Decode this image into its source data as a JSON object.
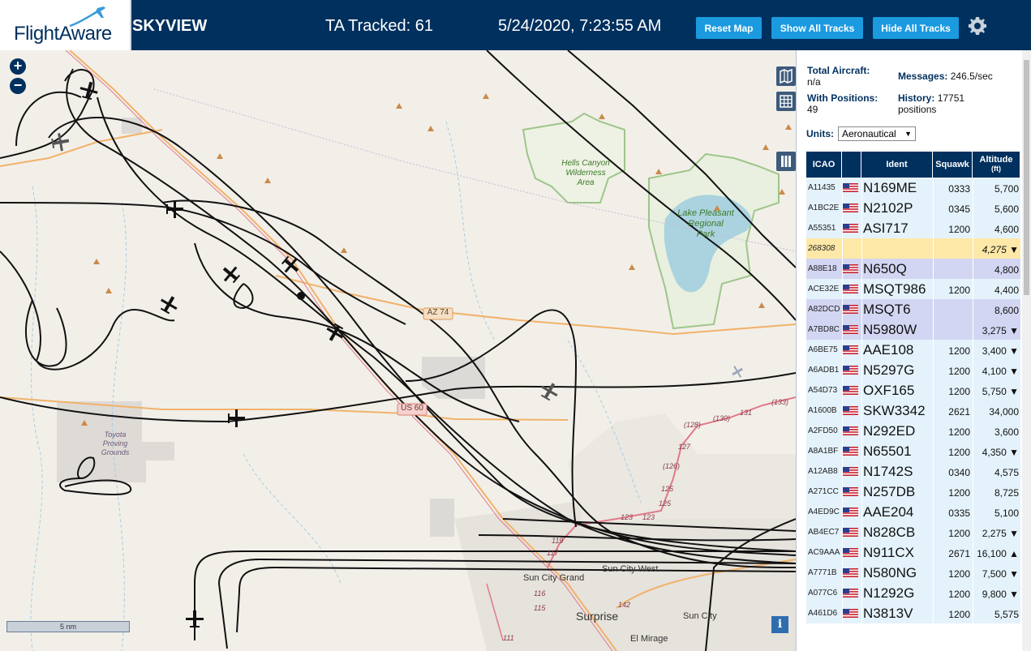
{
  "header": {
    "logo": "FlightAware",
    "app_title": "SKYVIEW",
    "tracked": "TA Tracked: 61",
    "datetime": "5/24/2020, 7:23:55 AM",
    "reset_map": "Reset Map",
    "show_all": "Show All Tracks",
    "hide_all": "Hide All Tracks"
  },
  "map": {
    "zoom_in": "+",
    "zoom_out": "−",
    "scale_label": "5 nm",
    "info": "i",
    "labels": {
      "hells_canyon": "Hells Canyon",
      "wilderness": "Wilderness",
      "area": "Area",
      "lake_pleasant": "Lake Pleasant",
      "regional": "Regional",
      "park": "Park",
      "toyota": "Toyota",
      "proving": "Proving",
      "grounds": "Grounds",
      "az74": "AZ 74",
      "us60": "US 60",
      "sun_city_grand": "Sun City Grand",
      "sun_city_west": "Sun City West",
      "surprise": "Surprise",
      "sun_city": "Sun City",
      "el_mirage": "El Mirage",
      "r133": "(133)",
      "r131": "131",
      "r130": "(130)",
      "r128": "(128)",
      "r127": "127",
      "r126": "(126)",
      "r125": "125",
      "r125b": "125",
      "r123": "123",
      "r123b": "123",
      "r119": "119",
      "r117": "117",
      "r116": "116",
      "r115": "115",
      "r142": "142",
      "r111": "111"
    }
  },
  "stats": {
    "total_label": "Total Aircraft:",
    "total_value": "n/a",
    "positions_label": "With Positions:",
    "positions_value": "49",
    "messages_label": "Messages:",
    "messages_value": "246.5/sec",
    "history_label": "History:",
    "history_value": "17751",
    "history_unit": "positions"
  },
  "units": {
    "label": "Units:",
    "selected": "Aeronautical"
  },
  "table": {
    "headers": {
      "icao": "ICAO",
      "ident": "Ident",
      "squawk": "Squawk",
      "altitude": "Altitude",
      "alt_unit": "(ft)"
    },
    "rows": [
      {
        "icao": "A11435",
        "ident": "N169ME",
        "squawk": "0333",
        "alt": "5,700",
        "bg": "n",
        "flag": true
      },
      {
        "icao": "A1BC2E",
        "ident": "N2102P",
        "squawk": "0345",
        "alt": "5,600",
        "bg": "n",
        "flag": true
      },
      {
        "icao": "A55351",
        "ident": "ASI717",
        "squawk": "1200",
        "alt": "4,600",
        "bg": "n",
        "flag": true
      },
      {
        "icao": "268308",
        "ident": "",
        "squawk": "",
        "alt": "4,275 ▼",
        "bg": "hl",
        "flag": false
      },
      {
        "icao": "A88E18",
        "ident": "N650Q",
        "squawk": "",
        "alt": "4,800",
        "bg": "alt",
        "flag": true
      },
      {
        "icao": "ACE32E",
        "ident": "MSQT986",
        "squawk": "1200",
        "alt": "4,400",
        "bg": "n",
        "flag": true
      },
      {
        "icao": "A82DCD",
        "ident": "MSQT6",
        "squawk": "",
        "alt": "8,600",
        "bg": "alt",
        "flag": true
      },
      {
        "icao": "A7BD8C",
        "ident": "N5980W",
        "squawk": "",
        "alt": "3,275 ▼",
        "bg": "alt",
        "flag": true
      },
      {
        "icao": "A6BE75",
        "ident": "AAE108",
        "squawk": "1200",
        "alt": "3,400 ▼",
        "bg": "n",
        "flag": true
      },
      {
        "icao": "A6ADB1",
        "ident": "N5297G",
        "squawk": "1200",
        "alt": "4,100 ▼",
        "bg": "n",
        "flag": true
      },
      {
        "icao": "A54D73",
        "ident": "OXF165",
        "squawk": "1200",
        "alt": "5,750 ▼",
        "bg": "n",
        "flag": true
      },
      {
        "icao": "A1600B",
        "ident": "SKW3342",
        "squawk": "2621",
        "alt": "34,000",
        "bg": "n",
        "flag": true
      },
      {
        "icao": "A2FD50",
        "ident": "N292ED",
        "squawk": "1200",
        "alt": "3,600",
        "bg": "n",
        "flag": true
      },
      {
        "icao": "A8A1BF",
        "ident": "N65501",
        "squawk": "1200",
        "alt": "4,350 ▼",
        "bg": "n",
        "flag": true
      },
      {
        "icao": "A12AB8",
        "ident": "N1742S",
        "squawk": "0340",
        "alt": "4,575",
        "bg": "n",
        "flag": true
      },
      {
        "icao": "A271CC",
        "ident": "N257DB",
        "squawk": "1200",
        "alt": "8,725",
        "bg": "n",
        "flag": true
      },
      {
        "icao": "A4ED9C",
        "ident": "AAE204",
        "squawk": "0335",
        "alt": "5,100",
        "bg": "n",
        "flag": true
      },
      {
        "icao": "AB4EC7",
        "ident": "N828CB",
        "squawk": "1200",
        "alt": "2,275 ▼",
        "bg": "n",
        "flag": true
      },
      {
        "icao": "AC9AAA",
        "ident": "N911CX",
        "squawk": "2671",
        "alt": "16,100 ▲",
        "bg": "n",
        "flag": true
      },
      {
        "icao": "A7771B",
        "ident": "N580NG",
        "squawk": "1200",
        "alt": "7,500 ▼",
        "bg": "n",
        "flag": true
      },
      {
        "icao": "A077C6",
        "ident": "N1292G",
        "squawk": "1200",
        "alt": "9,800 ▼",
        "bg": "n",
        "flag": true
      },
      {
        "icao": "A461D6",
        "ident": "N3813V",
        "squawk": "1200",
        "alt": "5,575",
        "bg": "n",
        "flag": true
      }
    ]
  },
  "colors": {
    "header": "#00305e",
    "button": "#1b9ae0",
    "row": "#e4f2fb",
    "row_alt": "#d3d6f2",
    "row_highlight": "#fde8a8",
    "track": "#111111",
    "lake": "#aad3df",
    "park_border": "#9fc58a",
    "road_orange": "#f1b26a",
    "road_red": "#e07a8a"
  }
}
